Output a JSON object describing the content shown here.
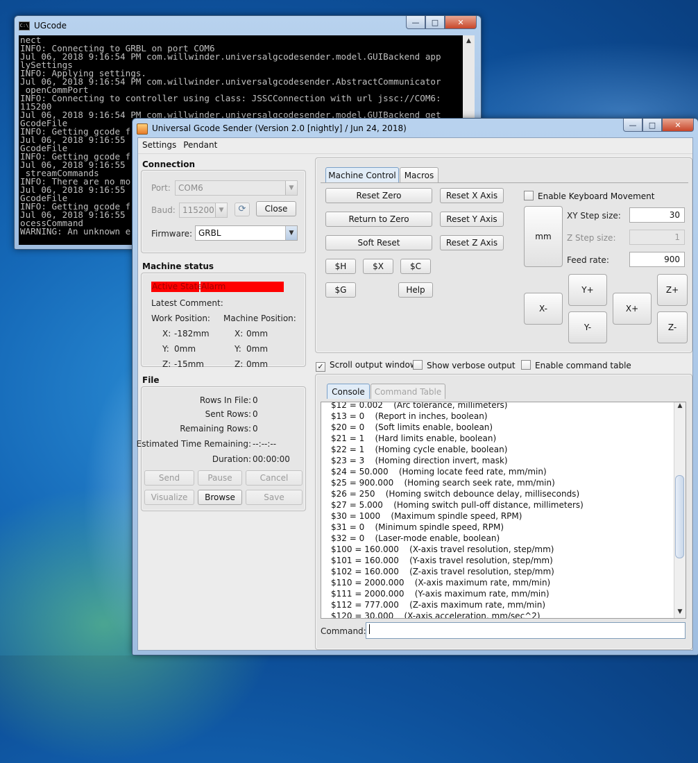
{
  "cmd_window": {
    "title": "UGcode",
    "icon_text": "C:\\",
    "lines": [
      "nect",
      "INFO: Connecting to GRBL on port COM6",
      "Jul 06, 2018 9:16:54 PM com.willwinder.universalgcodesender.model.GUIBackend app",
      "lySettings",
      "INFO: Applying settings.",
      "Jul 06, 2018 9:16:54 PM com.willwinder.universalgcodesender.AbstractCommunicator",
      " openCommPort",
      "INFO: Connecting to controller using class: JSSCConnection with url jssc://COM6:",
      "115200",
      "Jul 06, 2018 9:16:54 PM com.willwinder.universalgcodesender.model.GUIBackend get",
      "GcodeFile",
      "INFO: Getting gcode f",
      "Jul 06, 2018 9:16:55",
      "GcodeFile",
      "INFO: Getting gcode f",
      "Jul 06, 2018 9:16:55",
      " streamCommands",
      "INFO: There are no mo",
      "Jul 06, 2018 9:16:55",
      "GcodeFile",
      "INFO: Getting gcode f",
      "Jul 06, 2018 9:16:55",
      "ocessCommand",
      "WARNING: An unknown e"
    ]
  },
  "ugs_window": {
    "title": "Universal Gcode Sender (Version 2.0 [nightly]  / Jun 24, 2018)",
    "menu": [
      "Settings",
      "Pendant"
    ]
  },
  "connection": {
    "title": "Connection",
    "port_label": "Port:",
    "port_value": "COM6",
    "baud_label": "Baud:",
    "baud_value": "115200",
    "close_label": "Close",
    "firmware_label": "Firmware:",
    "firmware_value": "GRBL"
  },
  "machine_status": {
    "title": "Machine status",
    "active_state_label": "Active State:",
    "active_state_value": "Alarm",
    "latest_comment_label": "Latest Comment:",
    "work_position_label": "Work Position:",
    "machine_position_label": "Machine Position:",
    "work": {
      "x_label": "X:",
      "x": "-182mm",
      "y_label": "Y:",
      "y": "0mm",
      "z_label": "Z:",
      "z": "-15mm"
    },
    "machine": {
      "x_label": "X:",
      "x": "0mm",
      "y_label": "Y:",
      "y": "0mm",
      "z_label": "Z:",
      "z": "0mm"
    },
    "state_color": "#ff0000"
  },
  "file": {
    "title": "File",
    "rows_in_file_label": "Rows In File:",
    "rows_in_file": "0",
    "sent_rows_label": "Sent Rows:",
    "sent_rows": "0",
    "remaining_rows_label": "Remaining Rows:",
    "remaining_rows": "0",
    "est_time_label": "Estimated Time Remaining:",
    "est_time": "--:--:--",
    "duration_label": "Duration:",
    "duration": "00:00:00",
    "buttons": {
      "send": "Send",
      "pause": "Pause",
      "cancel": "Cancel",
      "visualize": "Visualize",
      "browse": "Browse",
      "save": "Save"
    }
  },
  "control_tabs": {
    "machine_control": "Machine Control",
    "macros": "Macros"
  },
  "machine_control": {
    "reset_zero": "Reset Zero",
    "return_to_zero": "Return to Zero",
    "soft_reset": "Soft Reset",
    "reset_x": "Reset X Axis",
    "reset_y": "Reset Y Axis",
    "reset_z": "Reset Z Axis",
    "cmd_h": "$H",
    "cmd_x": "$X",
    "cmd_c": "$C",
    "cmd_g": "$G",
    "help": "Help",
    "enable_keyboard": "Enable Keyboard Movement",
    "units": "mm",
    "xy_step_label": "XY Step size:",
    "xy_step": "30",
    "z_step_label": "Z Step size:",
    "z_step": "1",
    "feed_rate_label": "Feed rate:",
    "feed_rate": "900",
    "jog": {
      "x_minus": "X-",
      "x_plus": "X+",
      "y_plus": "Y+",
      "y_minus": "Y-",
      "z_plus": "Z+",
      "z_minus": "Z-"
    }
  },
  "options": {
    "scroll_output": "Scroll output window",
    "scroll_output_checked": true,
    "verbose": "Show verbose output",
    "command_table": "Enable command table"
  },
  "output_tabs": {
    "console": "Console",
    "command_table": "Command Table"
  },
  "console_lines": [
    "$12 = 0.002    (Arc tolerance, millimeters)",
    "$13 = 0    (Report in inches, boolean)",
    "$20 = 0    (Soft limits enable, boolean)",
    "$21 = 1    (Hard limits enable, boolean)",
    "$22 = 1    (Homing cycle enable, boolean)",
    "$23 = 3    (Homing direction invert, mask)",
    "$24 = 50.000    (Homing locate feed rate, mm/min)",
    "$25 = 900.000    (Homing search seek rate, mm/min)",
    "$26 = 250    (Homing switch debounce delay, milliseconds)",
    "$27 = 5.000    (Homing switch pull-off distance, millimeters)",
    "$30 = 1000    (Maximum spindle speed, RPM)",
    "$31 = 0    (Minimum spindle speed, RPM)",
    "$32 = 0    (Laser-mode enable, boolean)",
    "$100 = 160.000    (X-axis travel resolution, step/mm)",
    "$101 = 160.000    (Y-axis travel resolution, step/mm)",
    "$102 = 160.000    (Z-axis travel resolution, step/mm)",
    "$110 = 2000.000    (X-axis maximum rate, mm/min)",
    "$111 = 2000.000    (Y-axis maximum rate, mm/min)",
    "$112 = 777.000    (Z-axis maximum rate, mm/min)",
    "$120 = 30.000    (X-axis acceleration, mm/sec^2)"
  ],
  "command": {
    "label": "Command:",
    "value": ""
  }
}
